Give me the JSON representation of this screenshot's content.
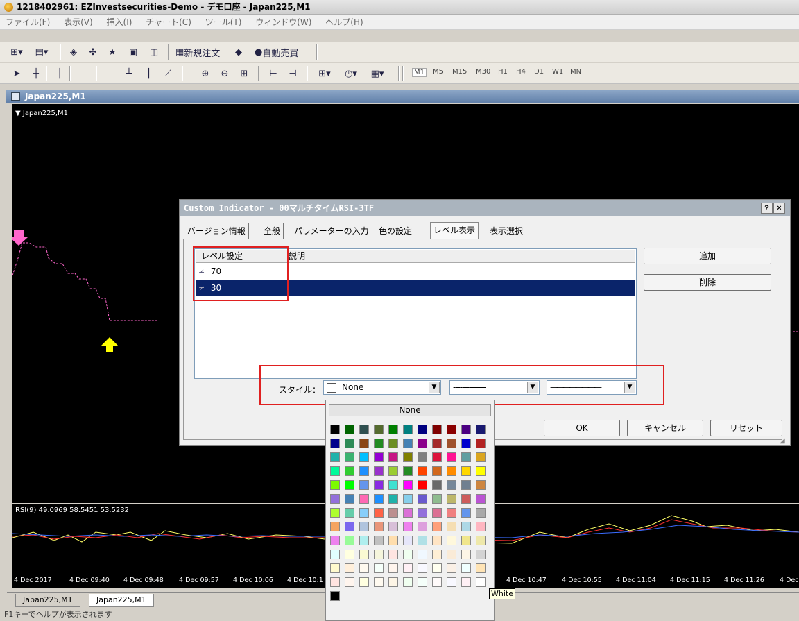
{
  "window": {
    "title": "1218402961: EZInvestsecurities-Demo - デモ口座 - Japan225,M1"
  },
  "menu": [
    "ファイル(F)",
    "表示(V)",
    "挿入(I)",
    "チャート(C)",
    "ツール(T)",
    "ウィンドウ(W)",
    "ヘルプ(H)"
  ],
  "toolbar1": {
    "new_order": "新規注文",
    "auto_trade": "自動売買"
  },
  "timeframes": [
    "M1",
    "M5",
    "M15",
    "M30",
    "H1",
    "H4",
    "D1",
    "W1",
    "MN"
  ],
  "chart": {
    "tab_title": "Japan225,M1",
    "label": "▼ Japan225,M1",
    "rsi_label": "RSI(9) 49.0969 58.5451 53.5232",
    "x_ticks": [
      "4 Dec 2017",
      "4 Dec 09:40",
      "4 Dec 09:48",
      "4 Dec 09:57",
      "4 Dec 10:06",
      "4 Dec 10:1",
      "4 Dec 10:47",
      "4 Dec 10:55",
      "4 Dec 11:04",
      "4 Dec 11:15",
      "4 Dec 11:26",
      "4 Dec"
    ]
  },
  "bottom_tabs": [
    "Japan225,M1",
    "Japan225,M1"
  ],
  "status": "F1キーでヘルプが表示されます",
  "dialog": {
    "title": "Custom Indicator - 00マルチタイムRSI-3TF",
    "help_btn": "?",
    "close_btn": "×",
    "tabs": [
      "バージョン情報",
      "全般",
      "パラメーターの入力",
      "色の設定",
      "レベル表示",
      "表示選択"
    ],
    "active_tab": "レベル表示",
    "columns": {
      "level": "レベル設定",
      "description": "説明"
    },
    "levels": [
      {
        "value": "70",
        "description": ""
      },
      {
        "value": "30",
        "description": ""
      }
    ],
    "add_button": "追加",
    "delete_button": "削除",
    "style_label": "スタイル：",
    "color_value": "None",
    "line_style": "--------------",
    "line_width": "————————",
    "ok_button": "OK",
    "cancel_button": "キャンセル",
    "reset_button": "リセット"
  },
  "palette": {
    "none_label": "None",
    "tooltip": "White",
    "rows": [
      [
        "#000000",
        "#006400",
        "#2f4f4f",
        "#556b2f",
        "#008000",
        "#008080",
        "#000080",
        "#800000",
        "#8b0000",
        "#4b0082",
        "#191970"
      ],
      [
        "#00008b",
        "#2e8b57",
        "#8b4513",
        "#228b22",
        "#6b8e23",
        "#4682b4",
        "#8b008b",
        "#a52a2a",
        "#a0522d",
        "#0000cd",
        "#b22222"
      ],
      [
        "#20b2aa",
        "#3cb371",
        "#00bfff",
        "#9400d3",
        "#c71585",
        "#808000",
        "#808080",
        "#dc143c",
        "#ff1493",
        "#5f9ea0",
        "#daa520"
      ],
      [
        "#00fa9a",
        "#32cd32",
        "#1e90ff",
        "#9932cc",
        "#9acd32",
        "#228b22",
        "#ff4500",
        "#d2691e",
        "#ff8c00",
        "#ffd700",
        "#ffff00"
      ],
      [
        "#7cfc00",
        "#00ff00",
        "#6495ed",
        "#8a2be2",
        "#40e0d0",
        "#ff00ff",
        "#ff0000",
        "#696969",
        "#778899",
        "#708090",
        "#cd853f"
      ],
      [
        "#9370db",
        "#4682b4",
        "#ff69b4",
        "#1e90ff",
        "#20b2aa",
        "#87ceeb",
        "#6a5acd",
        "#8fbc8f",
        "#bdb76b",
        "#cd5c5c",
        "#ba55d3"
      ],
      [
        "#adff2f",
        "#66cdaa",
        "#87cefa",
        "#ff6347",
        "#bc8f8f",
        "#da70d6",
        "#9370db",
        "#db7093",
        "#f08080",
        "#6495ed",
        "#a9a9a9"
      ],
      [
        "#f4a460",
        "#7b68ee",
        "#b0c4de",
        "#e9967a",
        "#d8bfd8",
        "#ee82ee",
        "#dda0dd",
        "#ffa07a",
        "#f5deb3",
        "#add8e6",
        "#ffb6c1"
      ],
      [
        "#ee82ee",
        "#98fb98",
        "#afeeee",
        "#c0c0c0",
        "#ffdead",
        "#e6e6fa",
        "#b0e0e6",
        "#ffe4c4",
        "#fff8dc",
        "#f0e68c",
        "#eee8aa"
      ],
      [
        "#e0ffff",
        "#ffffe0",
        "#fafad2",
        "#f5f5dc",
        "#ffe4e1",
        "#f0fff0",
        "#f0f8ff",
        "#ffefd5",
        "#faebd7",
        "#fdf5e6",
        "#d3d3d3"
      ],
      [
        "#fffacd",
        "#ffefdb",
        "#fffaf0",
        "#f5fffa",
        "#fff5ee",
        "#fff0f5",
        "#f8f8ff",
        "#fffff0",
        "#faf0e6",
        "#f0ffff",
        "#ffe4b5"
      ],
      [
        "#ffe4e1",
        "#fff5ee",
        "#ffffe0",
        "#fffaf0",
        "#fdf5e6",
        "#f0fff0",
        "#f5fffa",
        "#fffafa",
        "#f8f8ff",
        "#fff0f5",
        "#ffffff"
      ]
    ],
    "last": "#000000"
  },
  "colors": {
    "chart_bg": "#000000",
    "selection": "#0a246a",
    "highlight": "#e02020"
  }
}
